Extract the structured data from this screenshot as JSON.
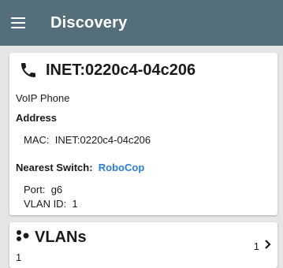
{
  "appbar": {
    "title": "Discovery",
    "menu_icon": "hamburger-menu-icon"
  },
  "device": {
    "icon": "phone-icon",
    "name": "INET:0220c4-04c206",
    "type": "VoIP Phone",
    "address_heading": "Address",
    "mac_label": "MAC:",
    "mac_value": "INET:0220c4-04c206",
    "nearest_switch_label": "Nearest Switch:",
    "nearest_switch_value": "RoboCop",
    "port_label": "Port:",
    "port_value": "g6",
    "vlan_id_label": "VLAN ID:",
    "vlan_id_value": "1"
  },
  "vlans": {
    "icon": "vlans-dots-icon",
    "label": "VLANs",
    "subvalue": "1",
    "count": "1",
    "chevron_icon": "chevron-right-icon"
  },
  "colors": {
    "appbar": "#546e7a",
    "background": "#e6e6e6",
    "card": "#ffffff",
    "link": "#2a7fd4"
  }
}
